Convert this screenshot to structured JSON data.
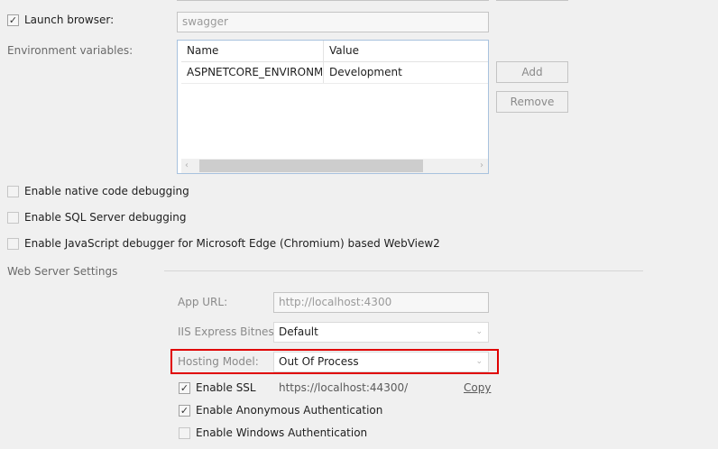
{
  "launch_browser": {
    "label": "Launch browser:",
    "checked": true,
    "value": "swagger"
  },
  "env_vars": {
    "label": "Environment variables:",
    "columns": [
      "Name",
      "Value"
    ],
    "rows": [
      {
        "name": "ASPNETCORE_ENVIRONMENT",
        "value": "Development"
      }
    ],
    "add_label": "Add",
    "remove_label": "Remove"
  },
  "options": {
    "native_debug": {
      "label": "Enable native code debugging",
      "checked": false
    },
    "sql_debug": {
      "label": "Enable SQL Server debugging",
      "checked": false
    },
    "js_debug": {
      "label": "Enable JavaScript debugger for Microsoft Edge (Chromium) based WebView2",
      "checked": false
    }
  },
  "web_server": {
    "title": "Web Server Settings",
    "app_url_label": "App URL:",
    "app_url_value": "http://localhost:4300",
    "bitness_label": "IIS Express Bitness:",
    "bitness_value": "Default",
    "hosting_label": "Hosting Model:",
    "hosting_value": "Out Of Process",
    "ssl_label": "Enable SSL",
    "ssl_checked": true,
    "ssl_url": "https://localhost:44300/",
    "copy_label": "Copy",
    "anon_label": "Enable Anonymous Authentication",
    "anon_checked": true,
    "win_label": "Enable Windows Authentication",
    "win_checked": false
  },
  "colors": {
    "highlight": "#e00000",
    "grid_border": "#a8c2de"
  }
}
